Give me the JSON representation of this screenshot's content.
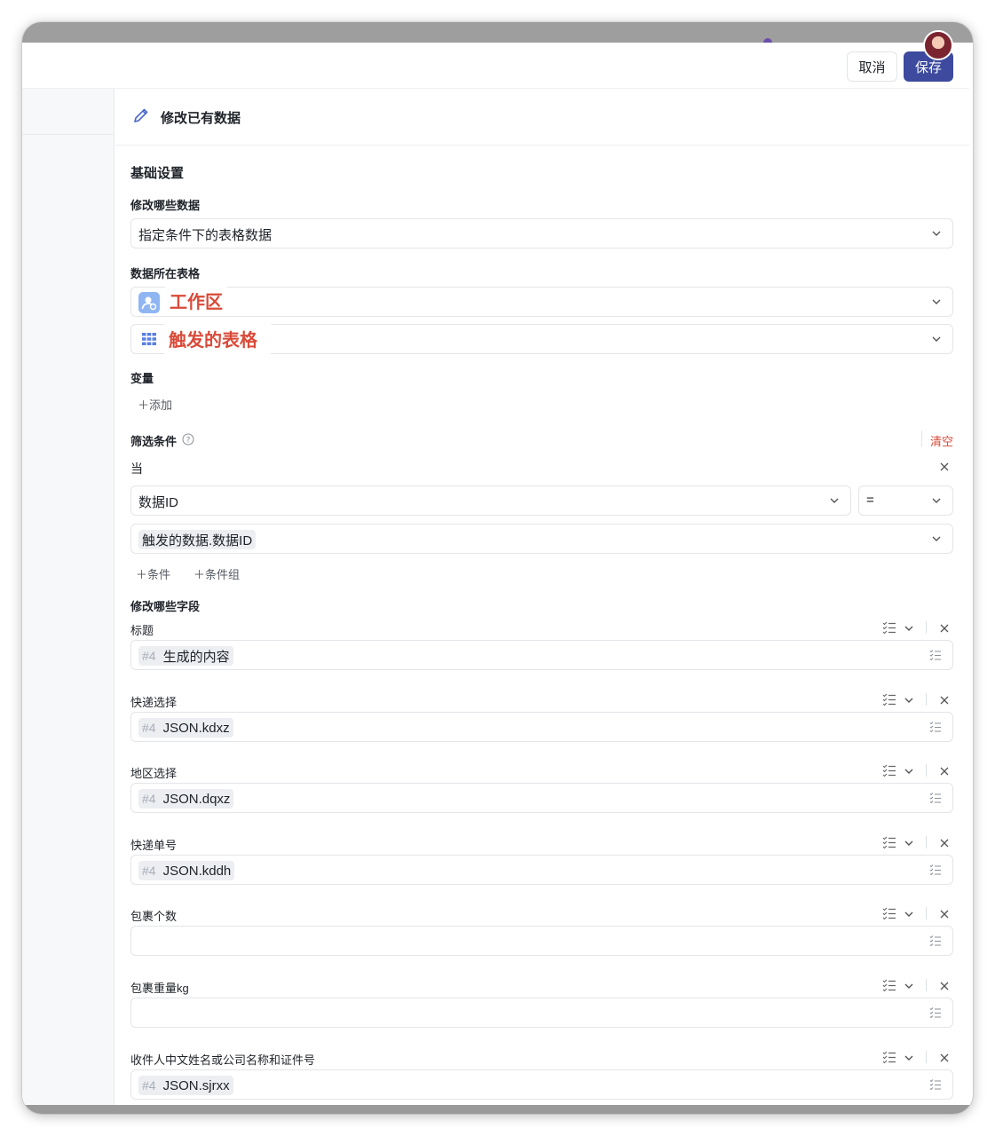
{
  "header": {
    "cancel_label": "取消",
    "save_label": "保存"
  },
  "panel": {
    "title": "修改已有数据"
  },
  "basic": {
    "section_title": "基础设置",
    "which_data_label": "修改哪些数据",
    "which_data_value": "指定条件下的表格数据",
    "table_label": "数据所在表格",
    "workspace_value": "工作区",
    "table_value": "触发的表格"
  },
  "variables": {
    "label": "变量",
    "add_label": "添加"
  },
  "filter": {
    "label": "筛选条件",
    "clear_label": "清空",
    "when_label": "当",
    "field_value": "数据ID",
    "operator_value": "=",
    "value_chip": "触发的数据.数据ID",
    "add_condition_label": "条件",
    "add_group_label": "条件组"
  },
  "fields_section": {
    "label": "修改哪些字段",
    "items": [
      {
        "name": "标题",
        "tag": "#4",
        "value": "生成的内容"
      },
      {
        "name": "快递选择",
        "tag": "#4",
        "value": "JSON.kdxz"
      },
      {
        "name": "地区选择",
        "tag": "#4",
        "value": "JSON.dqxz"
      },
      {
        "name": "快递单号",
        "tag": "#4",
        "value": "JSON.kddh"
      },
      {
        "name": "包裹个数",
        "tag": "",
        "value": ""
      },
      {
        "name": "包裹重量kg",
        "tag": "",
        "value": ""
      },
      {
        "name": "收件人中文姓名或公司名称和证件号",
        "tag": "#4",
        "value": "JSON.sjrxx"
      }
    ]
  },
  "colors": {
    "primary": "#3d4a9e",
    "danger": "#d94a38",
    "annotation": "#d94a38"
  }
}
